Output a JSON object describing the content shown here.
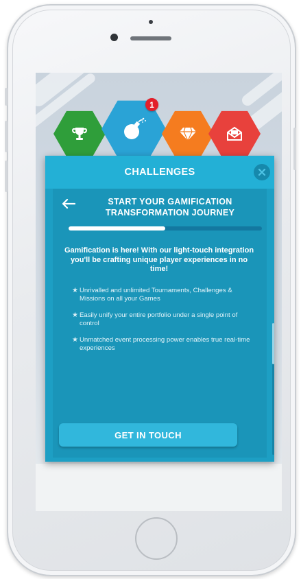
{
  "tabs": [
    {
      "name": "Trophy",
      "icon": "trophy-icon",
      "color": "#2f9e3a",
      "active": false
    },
    {
      "name": "Challenges",
      "icon": "bomb-icon",
      "color": "#2aa3d6",
      "active": true,
      "badge": "1"
    },
    {
      "name": "Rewards",
      "icon": "diamond-icon",
      "color": "#f57c1f",
      "active": false
    },
    {
      "name": "Messages",
      "icon": "envelope-icon",
      "color": "#e8413c",
      "active": false
    }
  ],
  "panel": {
    "title": "CHALLENGES",
    "close_icon": "close-icon"
  },
  "journey": {
    "back_icon": "back-arrow-icon",
    "title": "START YOUR GAMIFICATION TRANSFORMATION JOURNEY",
    "progress": 0.5
  },
  "intro": "Gamification is here! With our light-touch integration you'll be crafting unique player experiences in no time!",
  "features": [
    "Unrivalled and unlimited Tournaments, Challenges & Missions on all your Games",
    "Easily unify your entire portfolio under a single point of control",
    "Unmatched event processing power enables true real-time experiences"
  ],
  "cta": {
    "label": "GET IN TOUCH"
  },
  "colors": {
    "panel": "#1d9fc4",
    "header": "#23b0d6",
    "button": "#31b7dc"
  }
}
